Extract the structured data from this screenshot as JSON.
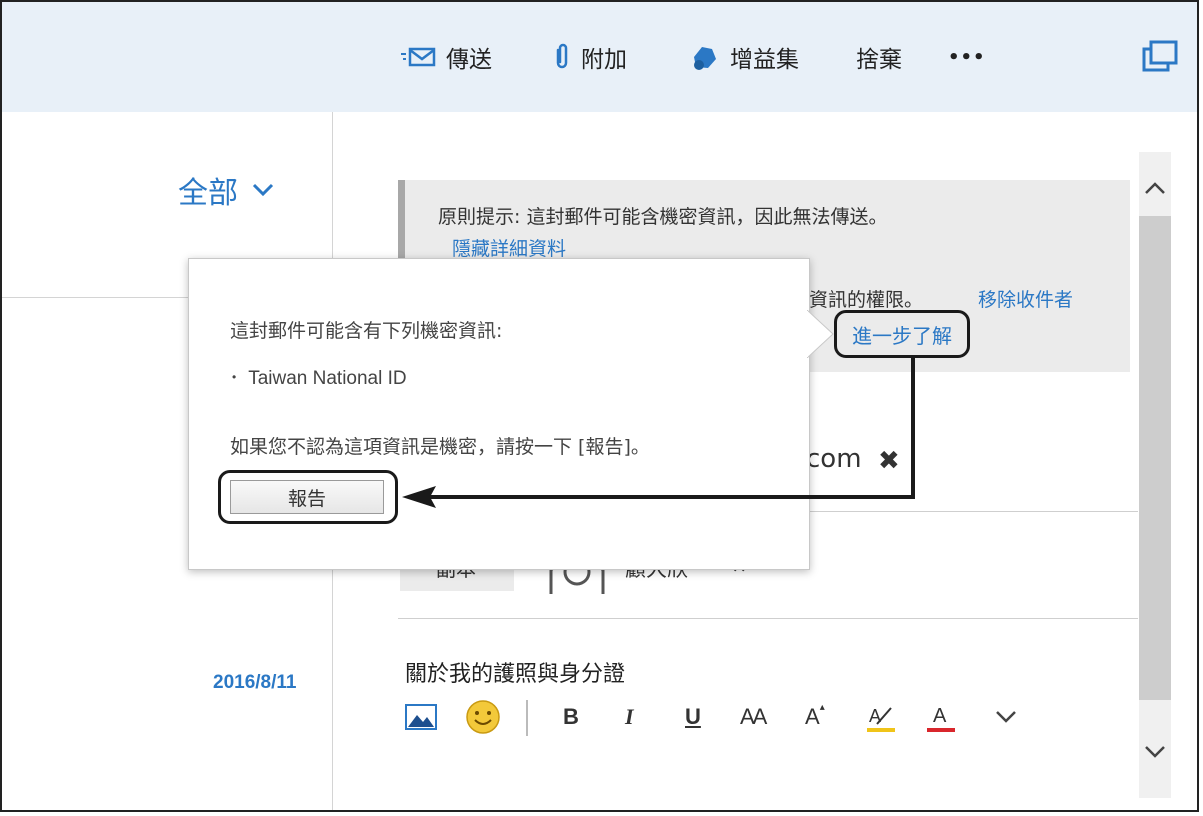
{
  "toolbar": {
    "send_label": "傳送",
    "attach_label": "附加",
    "addins_label": "增益集",
    "discard_label": "捨棄",
    "more_label": "•••"
  },
  "sidebar": {
    "filter_label": "全部",
    "date": "2016/8/11"
  },
  "policy_tip": {
    "text": "原則提示: 這封郵件可能含機密資訊，因此無法傳送。",
    "hide_details": "隱藏詳細資料",
    "permission_text": "項資訊的權限。",
    "remove_recipients": "移除收件者",
    "learn_more": "進一步了解"
  },
  "popup": {
    "intro": "這封郵件可能含有下列機密資訊:",
    "items": [
      "Taiwan National ID"
    ],
    "hint": "如果您不認為這項資訊是機密，請按一下 [報告]。",
    "report_button": "報告"
  },
  "compose": {
    "to_recipient_suffix": "com",
    "cc_label": "副本",
    "cc_name": "顧大欣",
    "subject": "關於我的護照與身分證"
  },
  "format_bar": {
    "bold": "B",
    "italic": "I",
    "underline": "U",
    "font_size": "AA",
    "grow": "A",
    "highlight_color": "#f0c419",
    "font_color": "#d9262c",
    "font_color_label": "A"
  },
  "colors": {
    "accent": "#2b78c5",
    "topbar_bg": "#e8f0f8",
    "policy_bg": "#ebebeb"
  }
}
